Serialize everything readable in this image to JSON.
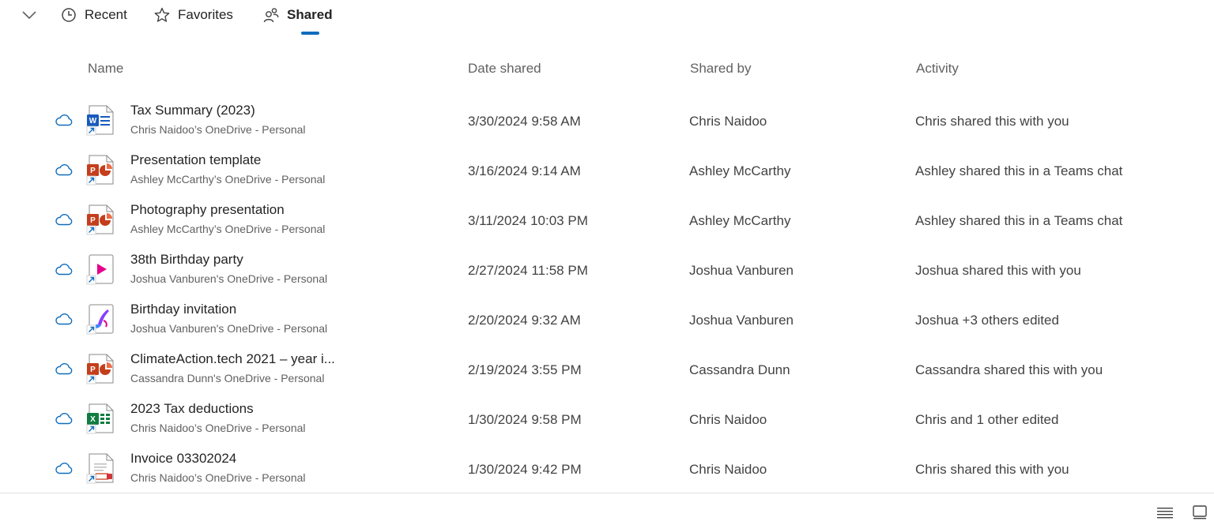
{
  "tabs": [
    {
      "label": "Recent",
      "icon": "clock-icon"
    },
    {
      "label": "Favorites",
      "icon": "star-icon"
    },
    {
      "label": "Shared",
      "icon": "people-icon",
      "active": true
    }
  ],
  "columns": {
    "name": "Name",
    "date": "Date shared",
    "by": "Shared by",
    "activity": "Activity"
  },
  "rows": [
    {
      "name": "Tax Summary (2023)",
      "location": "Chris Naidoo’s OneDrive - Personal",
      "date": "3/30/2024 9:58 AM",
      "by": "Chris Naidoo",
      "activity": "Chris shared this with you",
      "type": "word"
    },
    {
      "name": "Presentation template",
      "location": "Ashley McCarthy’s OneDrive - Personal",
      "date": "3/16/2024 9:14 AM",
      "by": "Ashley McCarthy",
      "activity": "Ashley shared this in a Teams chat",
      "type": "powerpoint"
    },
    {
      "name": "Photography presentation",
      "location": "Ashley McCarthy’s OneDrive - Personal",
      "date": "3/11/2024 10:03 PM",
      "by": "Ashley McCarthy",
      "activity": "Ashley shared this in a Teams chat",
      "type": "powerpoint"
    },
    {
      "name": "38th Birthday party",
      "location": "Joshua Vanburen's OneDrive - Personal",
      "date": "2/27/2024 11:58 PM",
      "by": "Joshua Vanburen",
      "activity": "Joshua shared this with you",
      "type": "video"
    },
    {
      "name": "Birthday invitation",
      "location": "Joshua Vanburen's OneDrive - Personal",
      "date": "2/20/2024 9:32 AM",
      "by": "Joshua Vanburen",
      "activity": "Joshua +3 others edited",
      "type": "designer"
    },
    {
      "name": "ClimateAction.tech 2021 – year i...",
      "location": "Cassandra Dunn's OneDrive - Personal",
      "date": "2/19/2024 3:55 PM",
      "by": "Cassandra Dunn",
      "activity": "Cassandra shared this with you",
      "type": "powerpoint"
    },
    {
      "name": "2023 Tax deductions",
      "location": "Chris Naidoo’s OneDrive - Personal",
      "date": "1/30/2024 9:58 PM",
      "by": "Chris Naidoo",
      "activity": "Chris and 1 other edited",
      "type": "excel"
    },
    {
      "name": "Invoice 03302024",
      "location": "Chris Naidoo’s OneDrive - Personal",
      "date": "1/30/2024 9:42 PM",
      "by": "Chris Naidoo",
      "activity": "Chris shared this with you",
      "type": "pdf"
    }
  ],
  "colors": {
    "accent": "#0f6cbd",
    "word": "#185abd",
    "powerpoint": "#c43e1c",
    "excel": "#107c41",
    "video": "#e3008c",
    "designer": "#8a3ffc"
  }
}
